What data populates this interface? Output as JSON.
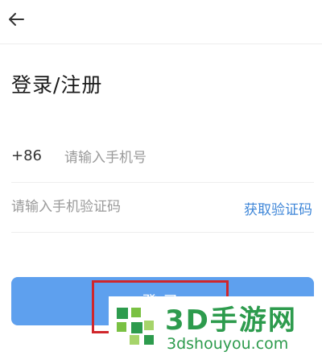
{
  "page": {
    "title": "登录/注册"
  },
  "phone": {
    "country_code": "+86",
    "placeholder": "请输入手机号",
    "value": ""
  },
  "code": {
    "placeholder": "请输入手机验证码",
    "value": "",
    "get_code_label": "获取验证码"
  },
  "login": {
    "label": "登录"
  },
  "watermark": {
    "title": "3D手游网",
    "subtitle": "3dshouyou.com"
  },
  "colors": {
    "accent": "#3e86d8",
    "button": "#5ea0ee",
    "highlight": "#d0262b",
    "watermark": "#2d9b4d"
  },
  "icons": {
    "back": "arrow-left-icon",
    "watermark_logo": "puzzle-logo-icon"
  }
}
